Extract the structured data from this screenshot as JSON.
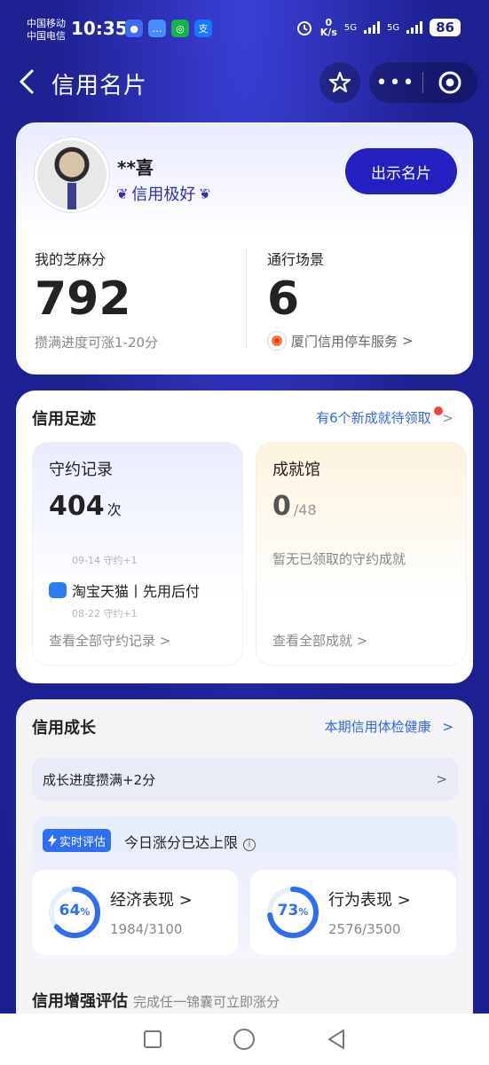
{
  "status_bar": {
    "carrier1": "中国移动",
    "carrier2": "中国电信",
    "time": "10:35",
    "net_speed_value": "0",
    "net_speed_unit": "K/s",
    "net1": "5G",
    "net2": "5G",
    "battery": "86"
  },
  "nav": {
    "title": "信用名片",
    "more": "•••"
  },
  "profile": {
    "name": "**喜",
    "credit_level": "信用极好",
    "show_card_button": "出示名片",
    "score_label": "我的芝麻分",
    "score_value": "792",
    "score_hint": "攒满进度可涨1-20分",
    "scene_label": "通行场景",
    "scene_value": "6",
    "scene_link": "厦门信用停车服务",
    "scene_chevron": ">"
  },
  "footprint": {
    "title": "信用足迹",
    "link": "有6个新成就待领取",
    "link_chevron": ">",
    "record": {
      "title": "守约记录",
      "count": "404",
      "unit": "次",
      "faded_top": "09-14 守约+1",
      "entry": "淘宝天猫丨先用后付",
      "faded_bottom": "08-22 守约+1",
      "footer": "查看全部守约记录",
      "footer_chevron": ">"
    },
    "achievement": {
      "title": "成就馆",
      "count": "0",
      "total": "/48",
      "empty_text": "暂无已领取的守约成就",
      "footer": "查看全部成就",
      "footer_chevron": ">"
    }
  },
  "growth": {
    "title": "信用成长",
    "link": "本期信用体检健康",
    "link_chevron": ">",
    "progress_text": "成长进度攒满+2分",
    "progress_chevron": ">",
    "realtime_tag": "实时评估",
    "realtime_status": "今日涨分已达上限",
    "info_icon": "i",
    "economic": {
      "percent_number": "64",
      "percent_sign": "%",
      "percent": 64,
      "label": "经济表现",
      "label_chevron": ">",
      "score": "1984/3100"
    },
    "behavior": {
      "percent_number": "73",
      "percent_sign": "%",
      "percent": 73,
      "label": "行为表现",
      "label_chevron": ">",
      "score": "2576/3500"
    },
    "enhance_title": "信用增强评估",
    "enhance_sub": "完成任一锦囊可立即涨分"
  },
  "colors": {
    "brand_blue": "#241fc0",
    "accent_blue": "#2e6ff2",
    "link_blue": "#3568d4",
    "red_dot": "#f04545"
  },
  "icons": [
    "back-icon",
    "star-icon",
    "more-icon",
    "mini-program-close-icon",
    "laurel-icon",
    "parking-logo-icon",
    "taobao-icon",
    "lightning-icon",
    "info-icon",
    "recent-apps-icon",
    "home-icon",
    "back-nav-icon"
  ]
}
